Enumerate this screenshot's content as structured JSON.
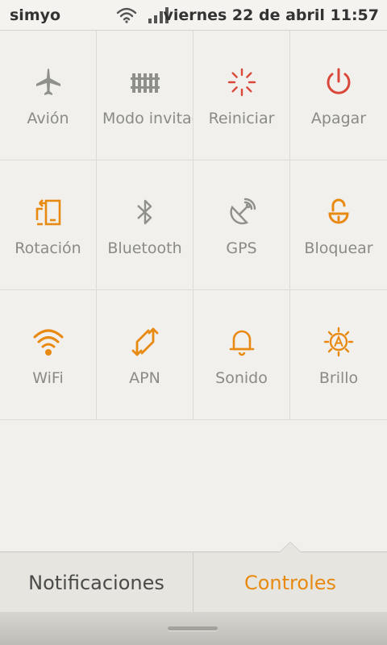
{
  "statusbar": {
    "carrier": "simyo",
    "datetime": "viernes 22 de abril 11:57",
    "icons": [
      "wifi-icon",
      "signal-icon"
    ]
  },
  "tiles": [
    {
      "label": "Avión",
      "icon": "airplane-icon",
      "color": "#8f8f8b"
    },
    {
      "label": "Modo invitado",
      "icon": "fence-icon",
      "color": "#8f8f8b"
    },
    {
      "label": "Reiniciar",
      "icon": "reboot-icon",
      "color": "#d9483b"
    },
    {
      "label": "Apagar",
      "icon": "power-icon",
      "color": "#d9483b"
    },
    {
      "label": "Rotación",
      "icon": "rotation-icon",
      "color": "#e88a12"
    },
    {
      "label": "Bluetooth",
      "icon": "bluetooth-icon",
      "color": "#8f8f8b"
    },
    {
      "label": "GPS",
      "icon": "gps-icon",
      "color": "#8f8f8b"
    },
    {
      "label": "Bloquear",
      "icon": "lock-icon",
      "color": "#e88a12"
    },
    {
      "label": "WiFi",
      "icon": "wifi-icon",
      "color": "#e88a12"
    },
    {
      "label": "APN",
      "icon": "data-arrows-icon",
      "color": "#e88a12"
    },
    {
      "label": "Sonido",
      "icon": "bell-icon",
      "color": "#e88a12"
    },
    {
      "label": "Brillo",
      "icon": "brightness-icon",
      "color": "#e88a12"
    }
  ],
  "tabs": {
    "notifications": "Notificaciones",
    "controls": "Controles",
    "active": "controls",
    "active_color": "#e88a12"
  }
}
